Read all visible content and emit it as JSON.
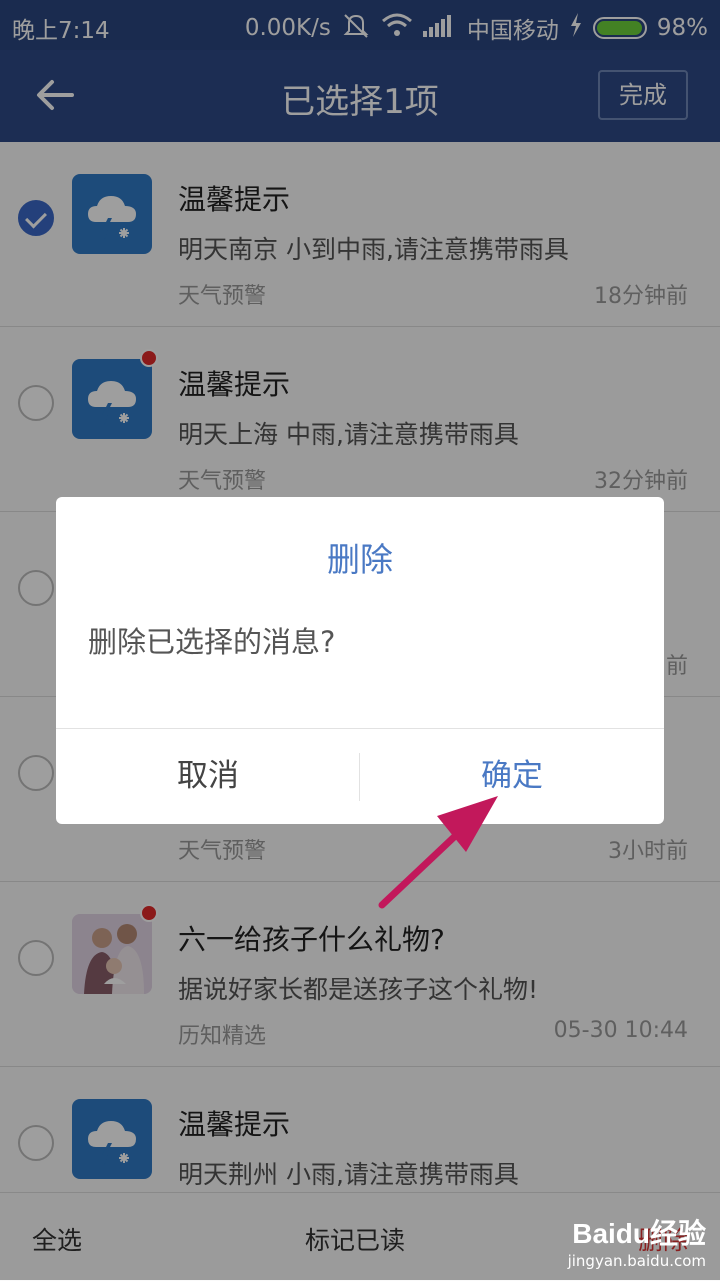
{
  "status_bar": {
    "time": "晚上7:14",
    "speed": "0.00K/s",
    "carrier": "中国移动",
    "battery": "98%",
    "battery_level": 0.98
  },
  "header": {
    "title": "已选择1项",
    "done_label": "完成"
  },
  "messages": [
    {
      "title": "温馨提示",
      "subtitle": "明天南京 小到中雨,请注意携带雨具",
      "tag": "天气预警",
      "time": "18分钟前",
      "selected": true,
      "unread": false,
      "icon": "weather-icon"
    },
    {
      "title": "温馨提示",
      "subtitle": "明天上海 中雨,请注意携带雨具",
      "tag": "天气预警",
      "time": "32分钟前",
      "selected": false,
      "unread": true,
      "icon": "weather-icon"
    },
    {
      "title": "",
      "subtitle": "",
      "tag": "",
      "time": "前",
      "selected": false,
      "unread": false,
      "icon": "weather-icon"
    },
    {
      "title": "",
      "subtitle": "",
      "tag": "天气预警",
      "time": "3小时前",
      "selected": false,
      "unread": false,
      "icon": "weather-icon"
    },
    {
      "title": "六一给孩子什么礼物?",
      "subtitle": "据说好家长都是送孩子这个礼物!",
      "tag": "历知精选",
      "time": "05-30 10:44",
      "selected": false,
      "unread": true,
      "icon": "family-photo"
    },
    {
      "title": "温馨提示",
      "subtitle": "明天荆州 小雨,请注意携带雨具",
      "tag": "",
      "time": "",
      "selected": false,
      "unread": false,
      "icon": "weather-icon"
    }
  ],
  "bottom_bar": {
    "select_all": "全选",
    "mark_read": "标记已读",
    "delete": "删除"
  },
  "dialog": {
    "title": "删除",
    "message": "删除已选择的消息?",
    "cancel": "取消",
    "confirm": "确定"
  },
  "watermark": {
    "brand": "Baidu经验",
    "url": "jingyan.baidu.com"
  },
  "colors": {
    "header": "#2e4a86",
    "accent": "#4a79c4",
    "annotation_arrow": "#c2185b"
  }
}
